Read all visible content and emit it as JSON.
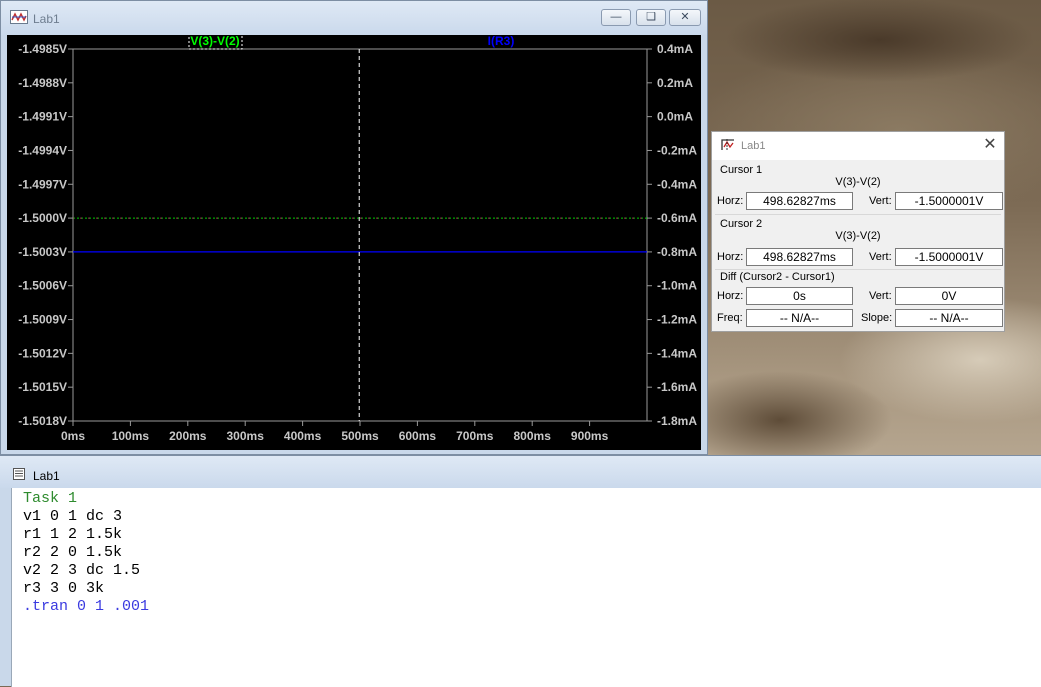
{
  "colors": {
    "trace_v": "#00ff00",
    "trace_i": "#0000ff",
    "plot_bg": "#000000",
    "comment": "#2e8b2e",
    "directive": "#3a3ae0"
  },
  "plot_window": {
    "title": "Lab1",
    "icon": "waveform-icon",
    "buttons": {
      "minimize": "minimize-icon",
      "restore": "restore-icon",
      "close": "close-icon"
    },
    "trace_labels": {
      "voltage": "V(3)-V(2)",
      "current": "I(R3)"
    }
  },
  "chart_data": {
    "type": "line",
    "xlabel": "",
    "xlim": [
      0,
      1000
    ],
    "x_ticks": [
      "0ms",
      "100ms",
      "200ms",
      "300ms",
      "400ms",
      "500ms",
      "600ms",
      "700ms",
      "800ms",
      "900ms"
    ],
    "y_left_ticks": [
      "-1.4985V",
      "-1.4988V",
      "-1.4991V",
      "-1.4994V",
      "-1.4997V",
      "-1.5000V",
      "-1.5003V",
      "-1.5006V",
      "-1.5009V",
      "-1.5012V",
      "-1.5015V",
      "-1.5018V"
    ],
    "y_right_ticks": [
      "0.4mA",
      "0.2mA",
      "0.0mA",
      "-0.2mA",
      "-0.4mA",
      "-0.6mA",
      "-0.8mA",
      "-1.0mA",
      "-1.2mA",
      "-1.4mA",
      "-1.6mA",
      "-1.8mA"
    ],
    "ylim_left": [
      -1.5018,
      -1.4985
    ],
    "ylim_right": [
      -1.8,
      0.4
    ],
    "series": [
      {
        "name": "V(3)-V(2)",
        "axis": "left",
        "unit": "V",
        "x": [
          0,
          1000
        ],
        "y": [
          -1.5000001,
          -1.5000001
        ]
      },
      {
        "name": "I(R3)",
        "axis": "right",
        "unit": "mA",
        "x": [
          0,
          1000
        ],
        "y": [
          -0.8,
          -0.8
        ]
      }
    ],
    "cursor_x": 498.62827,
    "grid": false
  },
  "cursor_dialog": {
    "title": "Lab1",
    "icon": "cursor-icon",
    "close": "close-icon",
    "cursor1": {
      "label": "Cursor 1",
      "trace": "V(3)-V(2)",
      "horz_label": "Horz:",
      "horz": "498.62827ms",
      "vert_label": "Vert:",
      "vert": "-1.5000001V"
    },
    "cursor2": {
      "label": "Cursor 2",
      "trace": "V(3)-V(2)",
      "horz_label": "Horz:",
      "horz": "498.62827ms",
      "vert_label": "Vert:",
      "vert": "-1.5000001V"
    },
    "diff": {
      "label": "Diff (Cursor2 - Cursor1)",
      "horz_label": "Horz:",
      "horz": "0s",
      "vert_label": "Vert:",
      "vert": "0V",
      "freq_label": "Freq:",
      "freq": "-- N/A--",
      "slope_label": "Slope:",
      "slope": "-- N/A--"
    }
  },
  "netlist_window": {
    "title": "Lab1",
    "icon": "document-icon",
    "lines": [
      {
        "text": "Task 1",
        "kind": "comment"
      },
      {
        "text": "v1 0 1 dc 3",
        "kind": "code"
      },
      {
        "text": "r1 1 2 1.5k",
        "kind": "code"
      },
      {
        "text": "r2 2 0 1.5k",
        "kind": "code"
      },
      {
        "text": "v2 2 3 dc 1.5",
        "kind": "code"
      },
      {
        "text": "r3 3 0 3k",
        "kind": "code"
      },
      {
        "text": ".tran 0 1 .001",
        "kind": "directive"
      }
    ]
  }
}
